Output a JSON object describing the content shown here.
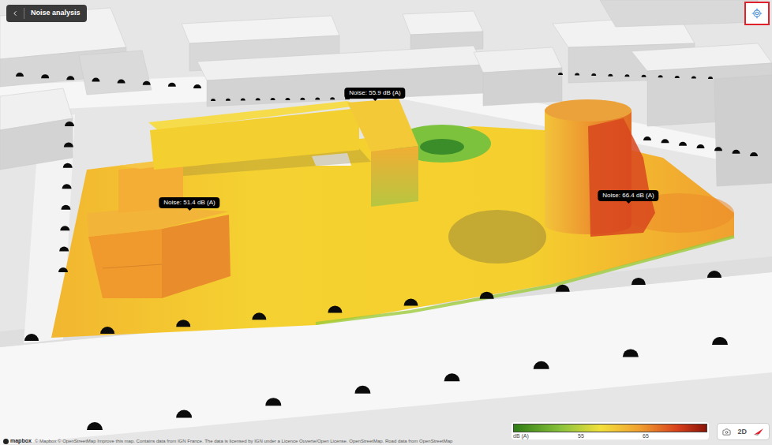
{
  "header": {
    "title": "Noise analysis"
  },
  "locate_button": {
    "highlighted": true
  },
  "noise_labels": [
    {
      "text": "Noise: 55.9 dB (A)"
    },
    {
      "text": "Noise: 51.4 dB (A)"
    },
    {
      "text": "Noise: 66.4 dB (A)"
    }
  ],
  "legend": {
    "unit": "dB (A)",
    "ticks": [
      "55",
      "65"
    ]
  },
  "view_controls": {
    "mode": "2D"
  },
  "attribution": "© Mapbox © OpenStreetMap Improve this map. Contains data from IGN France. The data is licensed by IGN under a Licence Ouverte/Open License. OpenStreetMap. Road data from OpenStreetMap",
  "logo": "mapbox"
}
